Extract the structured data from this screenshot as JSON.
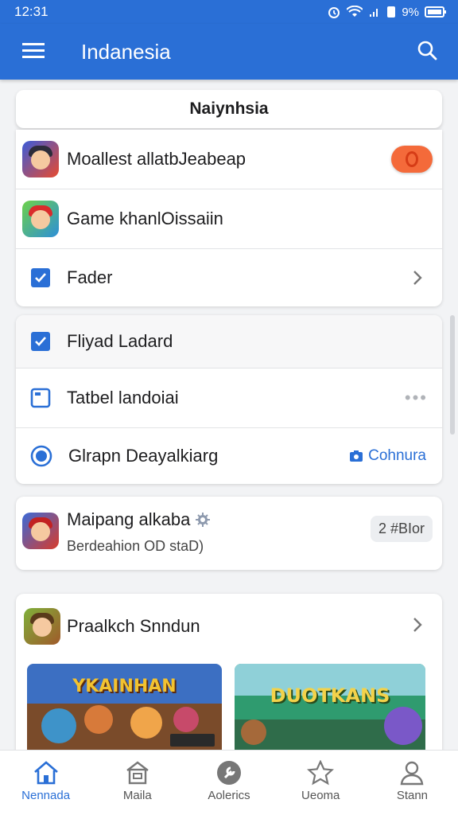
{
  "status_bar": {
    "time": "12:31",
    "battery": "9%"
  },
  "app_bar": {
    "title": "Indanesia"
  },
  "header_chip": {
    "label": "Naiynhsia"
  },
  "group1": {
    "items": [
      {
        "label": "Moallest allatbJeabeap",
        "icon": "game-hero-icon"
      },
      {
        "label": "Game khanlOissaiin",
        "icon": "game-mario-icon"
      },
      {
        "label": "Fader",
        "icon": "check-square-icon"
      }
    ]
  },
  "group2": {
    "items": [
      {
        "label": "Fliyad Ladard",
        "icon": "checkbox-icon"
      },
      {
        "label": "Tatbel landoiai",
        "icon": "folder-square-icon"
      },
      {
        "label": "Glrapn Deayalkiarg",
        "icon": "radio-circle-icon",
        "action": "Cohnura"
      }
    ]
  },
  "profile_card": {
    "title": "Maipang alkaba",
    "subtitle": "Berdeahion OD staD)",
    "badge": "2 #BIor"
  },
  "featured": {
    "title": "Praalkch Snndun",
    "banners": [
      {
        "title": "YKAINHAN",
        "accent": "#f2c230"
      },
      {
        "title": "DUOTKANS",
        "accent": "#f3d24a"
      }
    ]
  },
  "bottom_nav": [
    {
      "label": "Nennada",
      "icon": "home-icon",
      "active": true
    },
    {
      "label": "Maila",
      "icon": "store-icon",
      "active": false
    },
    {
      "label": "Aolerics",
      "icon": "wrench-icon",
      "active": false
    },
    {
      "label": "Ueoma",
      "icon": "star-icon",
      "active": false
    },
    {
      "label": "Stann",
      "icon": "person-icon",
      "active": false
    }
  ],
  "colors": {
    "primary": "#2a6fd6",
    "toggle": "#f46a3a"
  }
}
